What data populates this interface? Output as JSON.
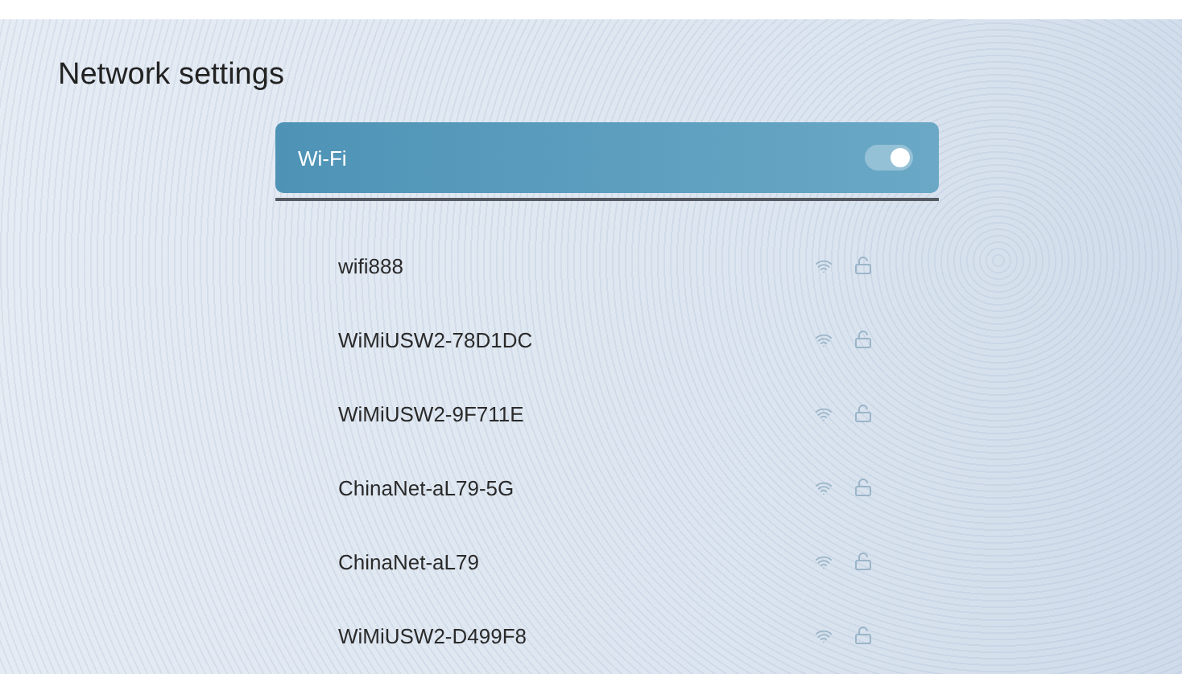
{
  "title": "Network settings",
  "wifi": {
    "label": "Wi-Fi",
    "on": true
  },
  "networks": [
    {
      "name": "wifi888"
    },
    {
      "name": "WiMiUSW2-78D1DC"
    },
    {
      "name": "WiMiUSW2-9F711E"
    },
    {
      "name": "ChinaNet-aL79-5G"
    },
    {
      "name": "ChinaNet-aL79"
    },
    {
      "name": "WiMiUSW2-D499F8"
    }
  ]
}
